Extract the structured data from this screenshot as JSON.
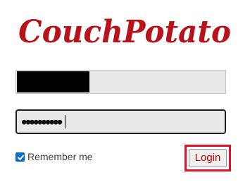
{
  "brand": {
    "name": "CouchPotato",
    "color": "#b8121b"
  },
  "login_form": {
    "username_value": "",
    "password_mask": "●●●●●●●●●●",
    "remember_label": "Remember me",
    "remember_checked": true,
    "login_label": "Login",
    "login_color": "#b30000",
    "highlight_color": "#e3122a"
  }
}
